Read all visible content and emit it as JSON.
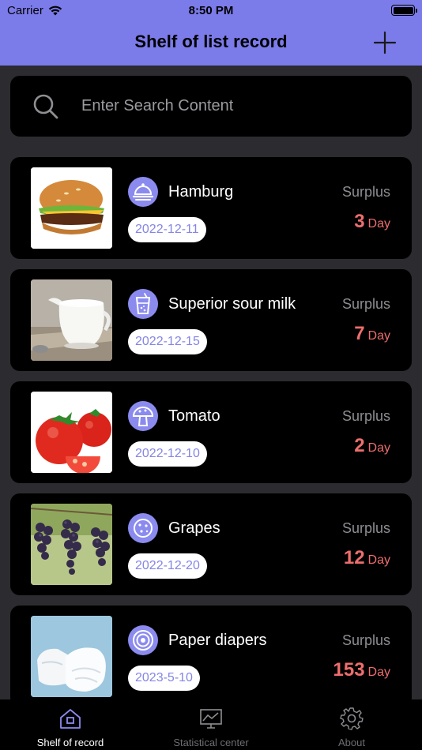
{
  "status_bar": {
    "carrier": "Carrier",
    "time": "8:50 PM"
  },
  "nav": {
    "title": "Shelf of list record",
    "add_icon": "plus-icon"
  },
  "search": {
    "placeholder": "Enter Search Content",
    "value": ""
  },
  "colors": {
    "nav_bg": "#7b7bea",
    "page_bg": "#2b2b30",
    "card_bg": "#000000",
    "accent": "#8585e6",
    "days_red": "#ee6e6e"
  },
  "items": [
    {
      "name": "Hamburg",
      "date": "2022-12-11",
      "surplus_label": "Surplus",
      "days": "3",
      "unit": "Day",
      "category_icon": "cloche-icon"
    },
    {
      "name": "Superior sour milk",
      "date": "2022-12-15",
      "surplus_label": "Surplus",
      "days": "7",
      "unit": "Day",
      "category_icon": "drink-icon"
    },
    {
      "name": "Tomato",
      "date": "2022-12-10",
      "surplus_label": "Surplus",
      "days": "2",
      "unit": "Day",
      "category_icon": "mushroom-icon"
    },
    {
      "name": "Grapes",
      "date": "2022-12-20",
      "surplus_label": "Surplus",
      "days": "12",
      "unit": "Day",
      "category_icon": "pizza-icon"
    },
    {
      "name": "Paper diapers",
      "date": "2023-5-10",
      "surplus_label": "Surplus",
      "days": "153",
      "unit": "Day",
      "category_icon": "target-icon"
    }
  ],
  "tabs": [
    {
      "label": "Shelf of record",
      "icon": "home-icon",
      "active": true
    },
    {
      "label": "Statistical center",
      "icon": "chart-icon",
      "active": false
    },
    {
      "label": "About",
      "icon": "gear-icon",
      "active": false
    }
  ]
}
